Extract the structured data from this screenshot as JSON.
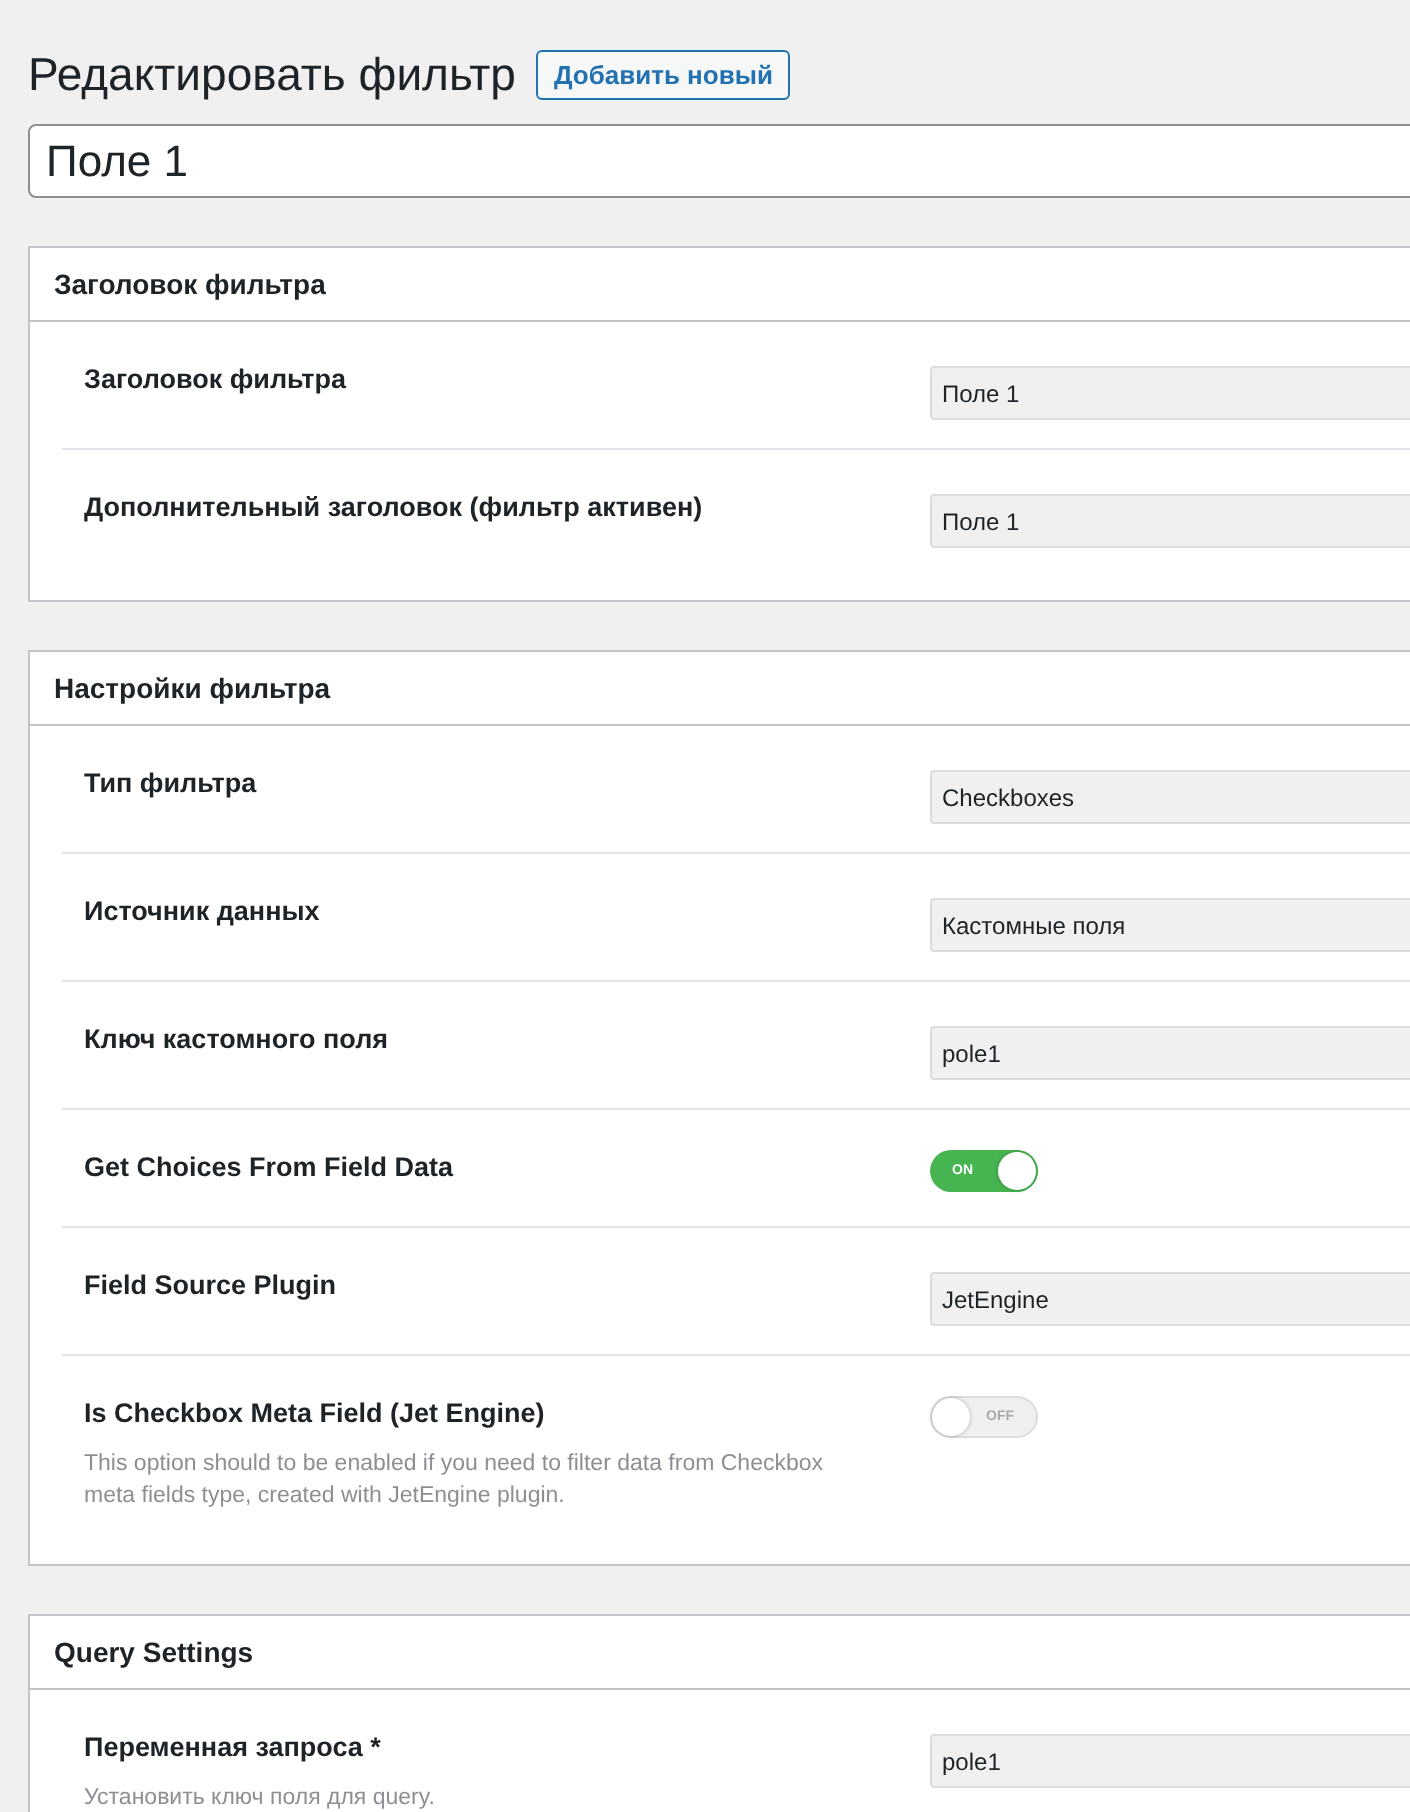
{
  "page_title": "Редактировать фильтр",
  "add_new_button": "Добавить новый",
  "title_field": {
    "value": "Поле 1"
  },
  "panels": [
    {
      "title": "Заголовок фильтра",
      "rows": [
        {
          "kind": "text",
          "label": "Заголовок фильтра",
          "value": "Поле 1"
        },
        {
          "kind": "text",
          "label": "Дополнительный заголовок (фильтр активен)",
          "value": "Поле 1"
        }
      ]
    },
    {
      "title": "Настройки фильтра",
      "rows": [
        {
          "kind": "select",
          "label": "Тип фильтра",
          "value": "Checkboxes"
        },
        {
          "kind": "select",
          "label": "Источник данных",
          "value": "Кастомные поля"
        },
        {
          "kind": "text",
          "label": "Ключ кастомного поля",
          "value": "pole1"
        },
        {
          "kind": "toggle",
          "label": "Get Choices From Field Data",
          "on": true,
          "state_text": "ON"
        },
        {
          "kind": "select",
          "label": "Field Source Plugin",
          "value": "JetEngine"
        },
        {
          "kind": "toggle",
          "label": "Is Checkbox Meta Field (Jet Engine)",
          "on": false,
          "state_text": "OFF",
          "description": "This option should to be enabled if you need to filter data from Checkbox meta fields type, created with JetEngine plugin."
        }
      ]
    },
    {
      "title": "Query Settings",
      "rows": [
        {
          "kind": "text",
          "label": "Переменная запроса *",
          "value": "pole1",
          "description": "Установить ключ поля для query."
        }
      ]
    }
  ]
}
